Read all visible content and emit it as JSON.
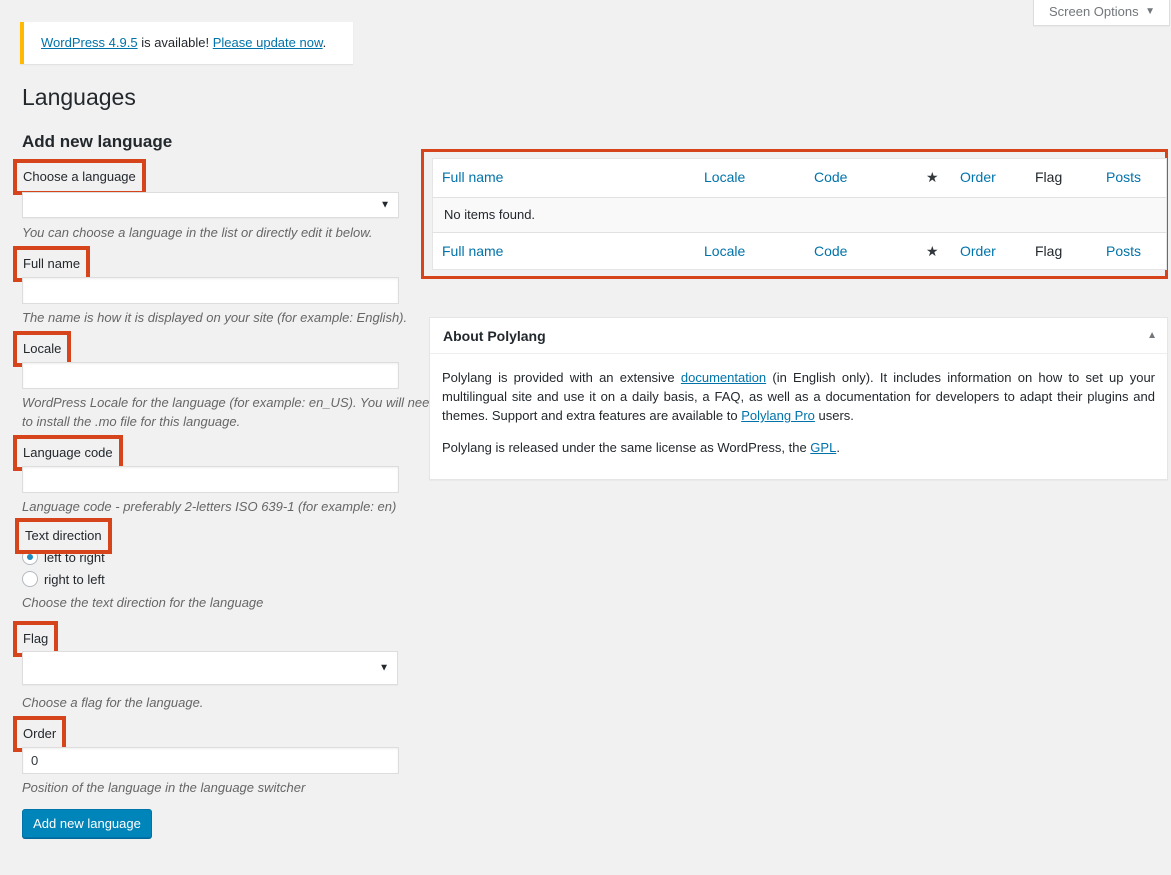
{
  "screen_options": {
    "label": "Screen Options"
  },
  "notice": {
    "version_link": "WordPress 4.9.5",
    "middle_text": " is available! ",
    "update_link": "Please update now",
    "end_text": "."
  },
  "page": {
    "title": "Languages",
    "subtitle": "Add new language"
  },
  "form": {
    "choose_language": {
      "label": "Choose a language",
      "value": "",
      "description": "You can choose a language in the list or directly edit it below."
    },
    "full_name": {
      "label": "Full name",
      "value": "",
      "description": "The name is how it is displayed on your site (for example: English)."
    },
    "locale": {
      "label": "Locale",
      "value": "",
      "description_line1": "WordPress Locale for the language (for example: en_US). You will need",
      "description_line2": "to install the .mo file for this language."
    },
    "language_code": {
      "label": "Language code",
      "value": "",
      "description": "Language code - preferably 2-letters ISO 639-1 (for example: en)"
    },
    "text_direction": {
      "label": "Text direction",
      "options": [
        "left to right",
        "right to left"
      ],
      "selected": "left to right",
      "description": "Choose the text direction for the language"
    },
    "flag": {
      "label": "Flag",
      "value": "",
      "description": "Choose a flag for the language."
    },
    "order": {
      "label": "Order",
      "value": "0",
      "description": "Position of the language in the language switcher"
    },
    "submit_label": "Add new language"
  },
  "table": {
    "columns": [
      "Full name",
      "Locale",
      "Code",
      "Order",
      "Flag",
      "Posts"
    ],
    "star_icon": "star-icon",
    "empty_message": "No items found."
  },
  "about": {
    "title": "About Polylang",
    "p1_a": "Polylang is provided with an extensive ",
    "p1_link1": "documentation",
    "p1_b": " (in English only). It includes information on how to set up your multilingual site and use it on a daily basis, a FAQ, as well as a documentation for developers to adapt their plugins and themes. Support and extra features are available to ",
    "p1_link2": "Polylang Pro",
    "p1_c": " users.",
    "p2_a": "Polylang is released under the same license as WordPress, the ",
    "p2_link": "GPL",
    "p2_b": "."
  },
  "colors": {
    "highlight": "#d5441a",
    "primary_button": "#0085ba",
    "link": "#0073aa",
    "notice_border": "#ffb900"
  }
}
